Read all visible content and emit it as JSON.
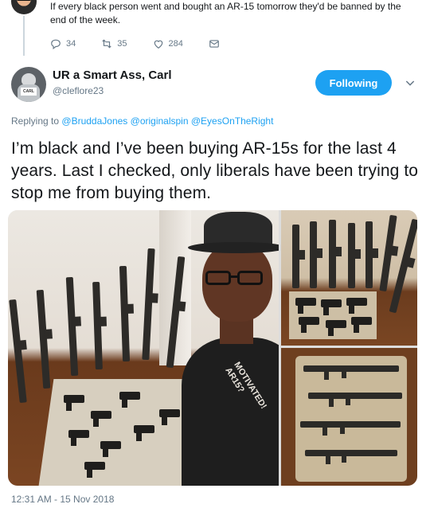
{
  "parent_tweet": {
    "text": "If every black person went and bought an AR-15 tomorrow they'd be banned by the end of the week.",
    "replies": "34",
    "retweets": "35",
    "likes": "284"
  },
  "tweet": {
    "display_name": "UR a Smart Ass, Carl",
    "handle": "@cleflore23",
    "follow_label": "Following",
    "replying_prefix": "Replying to",
    "mentions": [
      "@BruddaJones",
      "@originalspin",
      "@EyesOnTheRight"
    ],
    "text": "I’m black and I’ve been buying AR-15s for the last 4 years. Last I checked, only liberals have been trying to stop me from buying them.",
    "timestamp": "12:31 AM - 15 Nov 2018",
    "shirt_text": "MOTIVATED! AR15?",
    "avatar_sign": "CARL"
  },
  "colors": {
    "accent": "#1da1f2",
    "secondary_text": "#657786",
    "primary_text": "#14171a"
  },
  "icons": [
    "reply-icon",
    "retweet-icon",
    "like-icon",
    "message-icon",
    "chevron-down-icon"
  ]
}
